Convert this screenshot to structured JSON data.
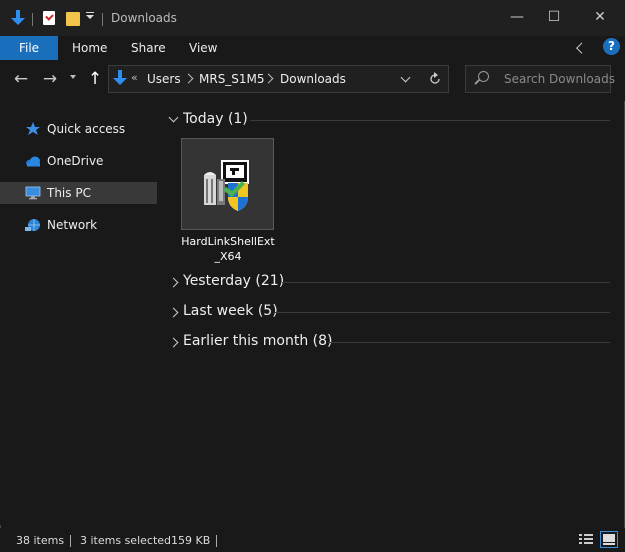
{
  "window": {
    "title": "Downloads"
  },
  "titlebar": {
    "minimize": "—",
    "maximize": "☐",
    "close": "✕"
  },
  "ribbon": {
    "tabs": [
      "File",
      "Home",
      "Share",
      "View"
    ],
    "help": "?"
  },
  "nav": {
    "breadcrumb_overflow": "«",
    "breadcrumb": [
      "Users",
      "MRS_S1M5",
      "Downloads"
    ],
    "search_placeholder": "Search Downloads"
  },
  "sidebar": {
    "items": [
      {
        "label": "Quick access",
        "icon": "star-icon"
      },
      {
        "label": "OneDrive",
        "icon": "cloud-icon"
      },
      {
        "label": "This PC",
        "icon": "computer-icon",
        "selected": true
      },
      {
        "label": "Network",
        "icon": "network-icon"
      }
    ]
  },
  "groups": [
    {
      "title": "Today (1)",
      "expanded": true
    },
    {
      "title": "Yesterday (21)",
      "expanded": false
    },
    {
      "title": "Last week (5)",
      "expanded": false
    },
    {
      "title": "Earlier this month (8)",
      "expanded": false
    }
  ],
  "files": [
    {
      "name_line1": "HardLinkShellExt",
      "name_line2": "_X64"
    }
  ],
  "status": {
    "items_count": "38 items",
    "selected": "3 items selected",
    "size": "159 KB"
  },
  "colors": {
    "accent": "#1a6fbd",
    "background": "#191919"
  }
}
